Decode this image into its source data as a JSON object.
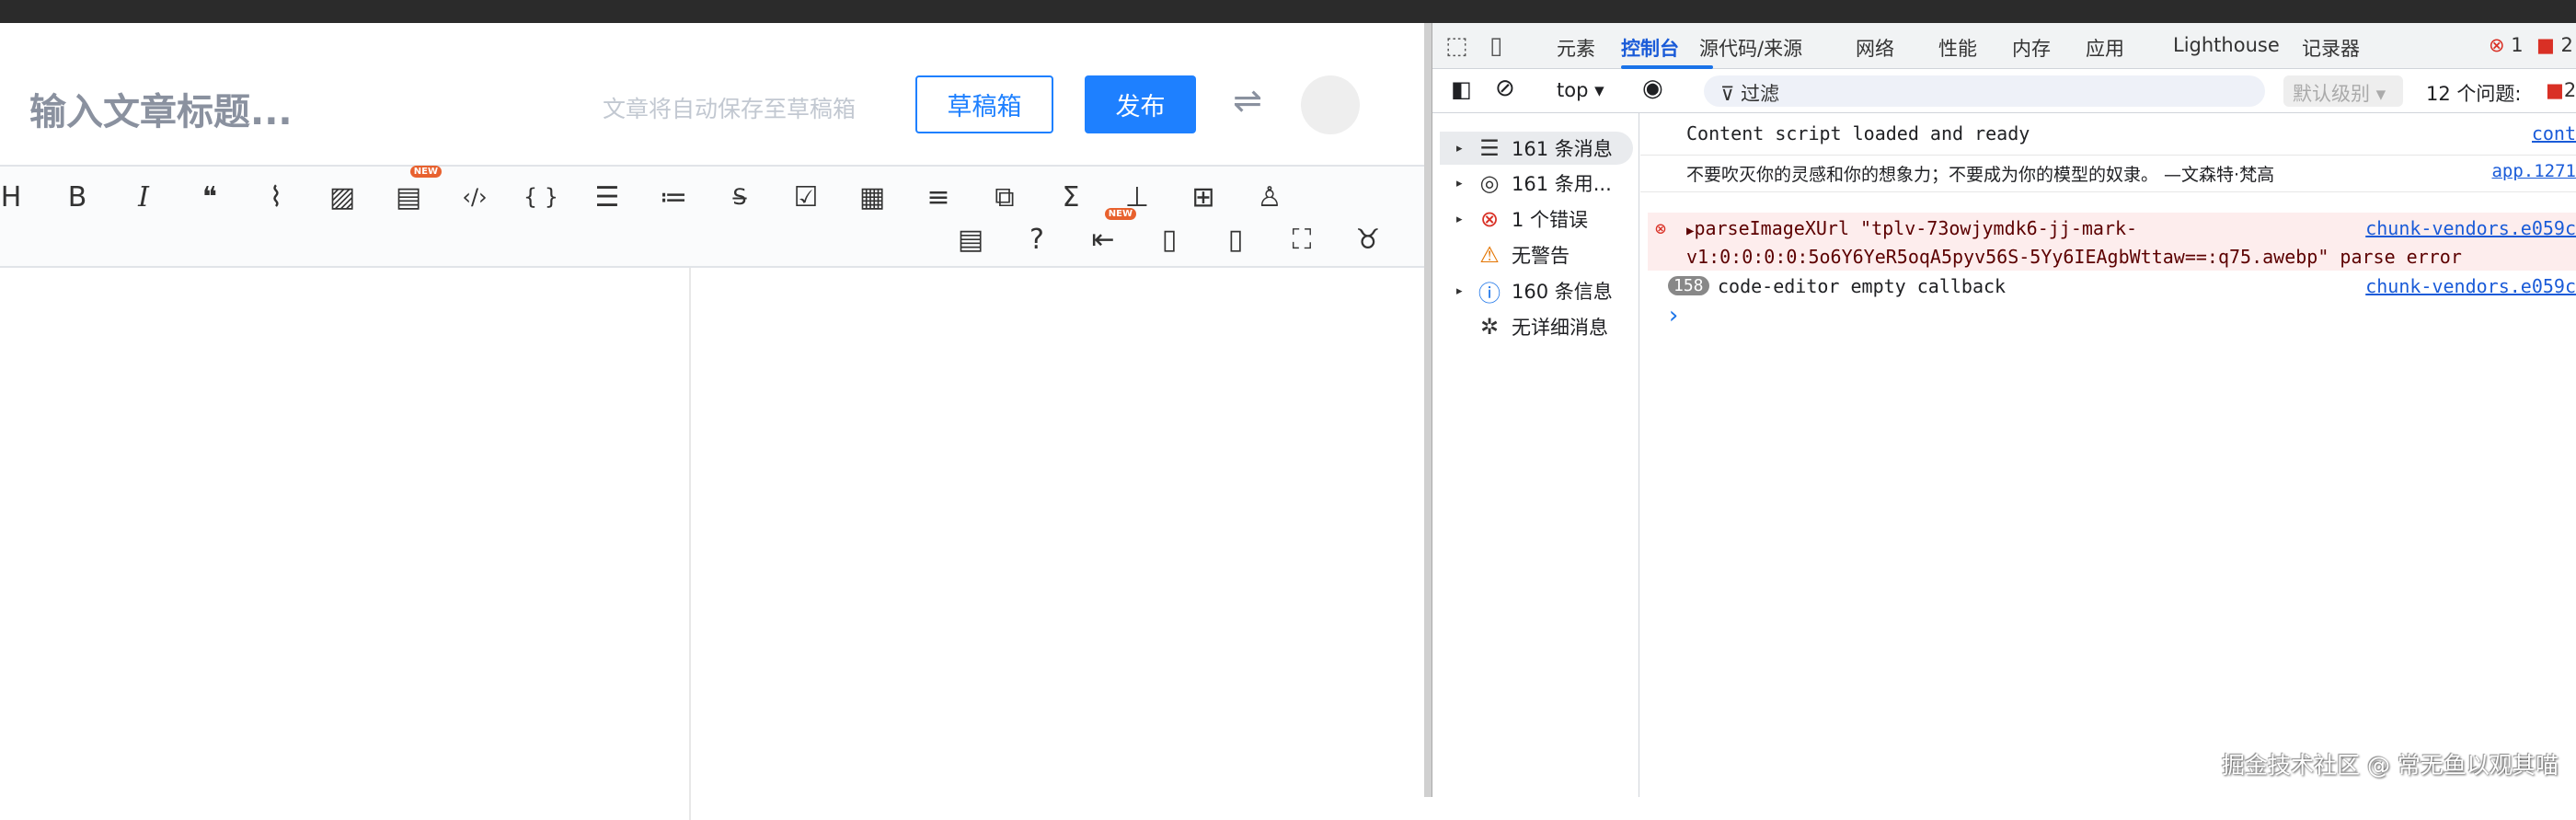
{
  "editor": {
    "title_placeholder": "输入文章标题...",
    "autosave_hint": "文章将自动保存至草稿箱",
    "draft_label": "草稿箱",
    "publish_label": "发布",
    "swap_icon": "⇌",
    "new_badge": "NEW",
    "toolbar_row1": [
      {
        "name": "heading",
        "glyph": "H"
      },
      {
        "name": "bold",
        "glyph": "B"
      },
      {
        "name": "italic",
        "glyph": "I"
      },
      {
        "name": "quote",
        "glyph": "❝"
      },
      {
        "name": "link",
        "glyph": "⌇"
      },
      {
        "name": "image",
        "glyph": "▨"
      },
      {
        "name": "code-block",
        "glyph": "▤",
        "new": true
      },
      {
        "name": "inline-code",
        "glyph": "‹/›"
      },
      {
        "name": "braces",
        "glyph": "{ }"
      },
      {
        "name": "unordered-list",
        "glyph": "☰"
      },
      {
        "name": "ordered-list",
        "glyph": "≔"
      },
      {
        "name": "strikethrough",
        "glyph": "S̶"
      },
      {
        "name": "task-list",
        "glyph": "☑"
      },
      {
        "name": "table",
        "glyph": "▦"
      },
      {
        "name": "align",
        "glyph": "≡"
      },
      {
        "name": "resize",
        "glyph": "⧉"
      },
      {
        "name": "formula",
        "glyph": "Σ"
      },
      {
        "name": "flowchart",
        "glyph": "⊥"
      },
      {
        "name": "more",
        "glyph": "⊞"
      },
      {
        "name": "brush",
        "glyph": "♙"
      }
    ],
    "toolbar_row2": [
      {
        "name": "toc",
        "glyph": "▤"
      },
      {
        "name": "help",
        "glyph": "?"
      },
      {
        "name": "import",
        "glyph": "⇤",
        "new": true
      },
      {
        "name": "right-pane",
        "glyph": "▯"
      },
      {
        "name": "left-pane",
        "glyph": "▯"
      },
      {
        "name": "fullscreen",
        "glyph": "⛶"
      },
      {
        "name": "github",
        "glyph": "♉"
      }
    ]
  },
  "devtools": {
    "tabs": [
      "元素",
      "控制台",
      "源代码/来源",
      "网络",
      "性能",
      "内存",
      "应用",
      "Lighthouse",
      "记录器"
    ],
    "active_tab": "控制台",
    "error_count": "1",
    "issue_count": "2",
    "context": "top ▾",
    "filter_placeholder": "过滤",
    "level": "默认级别 ▾",
    "issues_label": "12 个问题:",
    "issues_badge": "2",
    "sidebar": [
      {
        "label": "161 条消息",
        "icon": "☰",
        "color": "#333"
      },
      {
        "label": "161 条用...",
        "icon": "◎",
        "color": "#333"
      },
      {
        "label": "1 个错误",
        "icon": "⊗",
        "color": "#d93025"
      },
      {
        "label": "无警告",
        "icon": "⚠",
        "color": "#e37400"
      },
      {
        "label": "160 条信息",
        "icon": "ⓘ",
        "color": "#1a73e8"
      },
      {
        "label": "无详细消息",
        "icon": "✲",
        "color": "#333"
      }
    ],
    "messages": [
      {
        "text": "Content script loaded and ready",
        "source": "cont"
      },
      {
        "text": "不要吹灭你的灵感和你的想象力；不要成为你的模型的奴隶。 —文森特·梵高",
        "source": "app.1271"
      },
      {
        "text1": "parseImageXUrl \"tplv-73owjymdk6-jj-mark-",
        "text2": "v1:0:0:0:0:5o6Y6YeR5oqA5pyv56S-5Yy6IEAgbWttaw==:q75.awebp\" parse error",
        "source": "chunk-vendors.e059c"
      },
      {
        "count": "158",
        "text": "code-editor empty callback",
        "source": "chunk-vendors.e059c"
      }
    ],
    "prompt": "›"
  },
  "watermark": "掘金技术社区 @ 常无鱼以观其喵"
}
